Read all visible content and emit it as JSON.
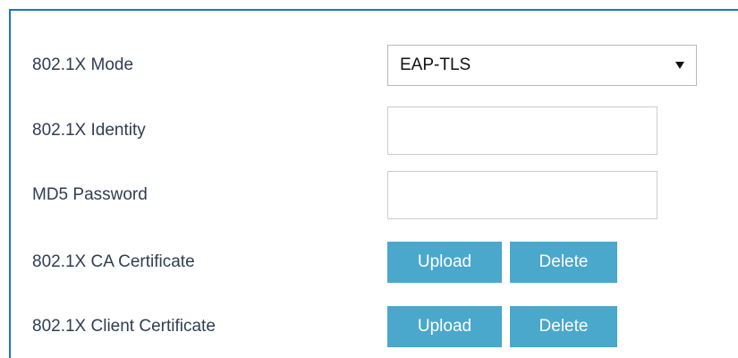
{
  "form": {
    "mode": {
      "label": "802.1X Mode",
      "selected": "EAP-TLS"
    },
    "identity": {
      "label": "802.1X Identity",
      "value": ""
    },
    "md5_password": {
      "label": "MD5 Password",
      "value": ""
    },
    "ca_certificate": {
      "label": "802.1X CA Certificate",
      "upload_label": "Upload",
      "delete_label": "Delete"
    },
    "client_certificate": {
      "label": "802.1X Client Certificate",
      "upload_label": "Upload",
      "delete_label": "Delete"
    }
  },
  "colors": {
    "panel_border": "#1a73c8",
    "button_bg": "#4aa8cc",
    "label_text": "#2f3e52"
  },
  "icons": {
    "dropdown": "triangle-down-icon"
  }
}
